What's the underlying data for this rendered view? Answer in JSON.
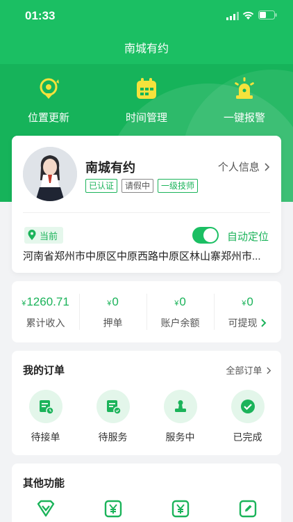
{
  "status_bar": {
    "time": "01:33"
  },
  "header": {
    "title": "南城有约"
  },
  "quick_actions": [
    {
      "label": "位置更新",
      "icon": "location-refresh-icon"
    },
    {
      "label": "时间管理",
      "icon": "calendar-icon"
    },
    {
      "label": "一键报警",
      "icon": "alarm-siren-icon"
    }
  ],
  "profile": {
    "name": "南城有约",
    "tags": [
      "已认证",
      "请假中",
      "一级技师"
    ],
    "info_link": "个人信息",
    "current_tag": "当前",
    "auto_locate_label": "自动定位",
    "auto_locate_on": true,
    "address": "河南省郑州市中原区中原西路中原区林山寨郑州市..."
  },
  "stats": [
    {
      "currency": "¥",
      "value": "1260.71",
      "label": "累计收入"
    },
    {
      "currency": "¥",
      "value": "0",
      "label": "押单"
    },
    {
      "currency": "¥",
      "value": "0",
      "label": "账户余额"
    },
    {
      "currency": "¥",
      "value": "0",
      "label": "可提现"
    }
  ],
  "orders": {
    "title": "我的订单",
    "all_label": "全部订单",
    "items": [
      {
        "label": "待接单",
        "icon": "pending-order-icon"
      },
      {
        "label": "待服务",
        "icon": "to-serve-icon"
      },
      {
        "label": "服务中",
        "icon": "in-service-icon"
      },
      {
        "label": "已完成",
        "icon": "completed-check-icon"
      }
    ]
  },
  "other": {
    "title": "其他功能",
    "icons": [
      "diamond-icon",
      "yuan-icon",
      "yuan-icon",
      "edit-icon"
    ]
  },
  "colors": {
    "brand_green": "#1bbf63",
    "brand_green_dark": "#1bb35a",
    "icon_yellow": "#f5e23c"
  }
}
